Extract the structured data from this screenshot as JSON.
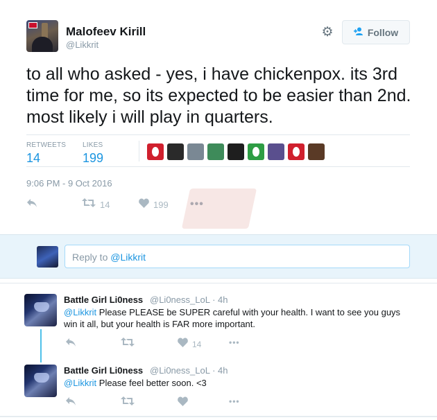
{
  "tweet": {
    "author_name": "Malofeev Kirill",
    "author_handle": "@Likkrit",
    "follow_label": "Follow",
    "text": "to all who asked - yes, i have chickenpox. its 3rd time for me, so its expected to be easier than 2nd. most likely i will play in quarters.",
    "retweets_label": "RETWEETS",
    "retweets_count": "14",
    "likes_label": "LIKES",
    "likes_count": "199",
    "timestamp": "9:06 PM - 9 Oct 2016",
    "actions": {
      "retweet_count": "14",
      "like_count": "199",
      "more": "•••"
    },
    "liker_avatars": [
      {
        "color": "#d0202e",
        "dot": true
      },
      {
        "color": "#2a2a2a",
        "dot": false
      },
      {
        "color": "#7a8894",
        "dot": false
      },
      {
        "color": "#3e8b5a",
        "dot": false
      },
      {
        "color": "#1e1e1e",
        "dot": false
      },
      {
        "color": "#2e9d44",
        "dot": true
      },
      {
        "color": "#5a4f8e",
        "dot": false
      },
      {
        "color": "#d0202e",
        "dot": true
      },
      {
        "color": "#5a3a26",
        "dot": false
      }
    ]
  },
  "reply_box": {
    "prefix": "Reply to ",
    "mention": "@Likkrit"
  },
  "replies": [
    {
      "name": "Battle Girl Li0ness",
      "handle": "@Li0ness_LoL",
      "time": "· 4h",
      "mention": "@Likkrit",
      "text": " Please PLEASE be SUPER careful with your health. I want to see you guys win it all, but your health is FAR more important.",
      "like_count": "14",
      "more": "•••"
    },
    {
      "name": "Battle Girl Li0ness",
      "handle": "@Li0ness_LoL",
      "time": "· 4h",
      "mention": "@Likkrit",
      "text": " Please feel better soon. <3",
      "like_count": "",
      "more": "•••"
    }
  ],
  "colors": {
    "accent": "#1b95e0",
    "muted": "#8899a6",
    "reply_bg": "#e8f4fb"
  },
  "icons": {
    "settings": "gear-icon",
    "follow": "user-plus-icon",
    "reply": "reply-icon",
    "retweet": "retweet-icon",
    "like": "heart-icon",
    "more": "more-icon"
  }
}
